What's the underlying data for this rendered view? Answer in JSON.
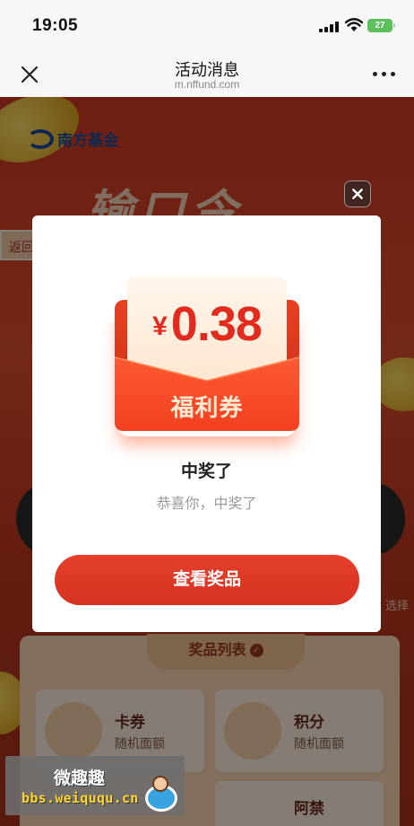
{
  "status_bar": {
    "time": "19:05",
    "battery": "27",
    "battery_color": "#5dc05f"
  },
  "nav": {
    "title": "活动消息",
    "subtitle": "m.nffund.com",
    "close_icon": "close-icon",
    "more_icon": "more-dots-icon"
  },
  "background_page": {
    "logo_text": "南方基金",
    "banner_title": "输口令",
    "back_tab": "返回",
    "side_hint": "选择",
    "prize_list": {
      "title": "奖品列表",
      "items": [
        {
          "name": "卡券",
          "desc": "随机面额"
        },
        {
          "name": "积分",
          "desc": "随机面额"
        },
        {
          "name": "阿禁",
          "desc": ""
        }
      ]
    }
  },
  "modal": {
    "currency": "¥",
    "amount": "0.38",
    "coupon_label": "福利券",
    "title": "中奖了",
    "subtitle": "恭喜你，中奖了",
    "button_label": "查看奖品",
    "accent_color": "#d63122"
  },
  "watermark": {
    "name": "微趣趣",
    "url": "bbs.weiququ.cn"
  }
}
